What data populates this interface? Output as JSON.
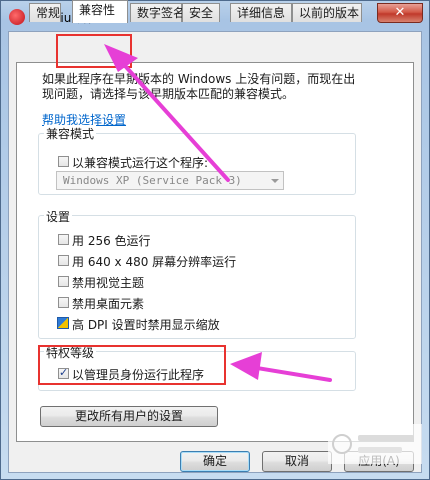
{
  "window": {
    "title": "XiuXiu 属性",
    "close_label": "✕"
  },
  "tabs": [
    {
      "label": "常规"
    },
    {
      "label": "兼容性"
    },
    {
      "label": "数字签名"
    },
    {
      "label": "安全"
    },
    {
      "label": "详细信息"
    },
    {
      "label": "以前的版本"
    }
  ],
  "content": {
    "intro_line1": "如果此程序在早期版本的 Windows 上没有问题，而现在出",
    "intro_line2": "现问题，请选择与该早期版本匹配的兼容模式。",
    "help_link": "帮助我选择设置",
    "compat_group": {
      "title": "兼容模式",
      "checkbox_label": "以兼容模式运行这个程序:",
      "select_value": "Windows XP (Service Pack 3)"
    },
    "settings_group": {
      "title": "设置",
      "options": [
        {
          "label": "用 256 色运行"
        },
        {
          "label": "用 640 x 480 屏幕分辨率运行"
        },
        {
          "label": "禁用视觉主题"
        },
        {
          "label": "禁用桌面元素"
        },
        {
          "label": "高 DPI 设置时禁用显示缩放"
        }
      ]
    },
    "privilege_group": {
      "title": "特权等级",
      "checkbox_label": "以管理员身份运行此程序",
      "checked": true
    },
    "all_users_button": "更改所有用户的设置"
  },
  "footer": {
    "ok": "确定",
    "cancel": "取消",
    "apply": "应用(A)"
  },
  "colors": {
    "annotation_red": "#e8322f",
    "annotation_magenta": "#e63fd6",
    "link": "#0066cc"
  }
}
